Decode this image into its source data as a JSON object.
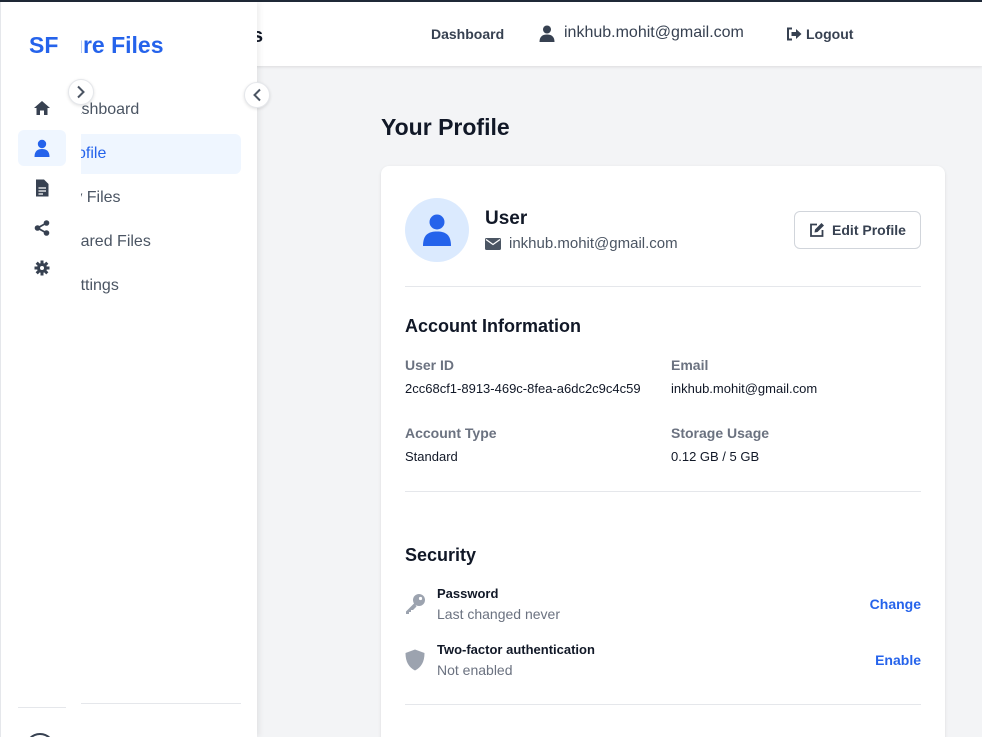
{
  "topbar": {
    "brand_fragment": "s",
    "nav_dashboard": "Dashboard",
    "user_email": "inkhub.mohit@gmail.com",
    "logout_label": "Logout"
  },
  "sidebar": {
    "brand_full": "Secure Files",
    "brand_short": "SF",
    "items": [
      {
        "label": "Dashboard",
        "icon": "home-icon",
        "active": false
      },
      {
        "label": "Profile",
        "icon": "user-icon",
        "active": true
      },
      {
        "label": "My Files",
        "icon": "file-icon",
        "active": false
      },
      {
        "label": "Shared Files",
        "icon": "share-icon",
        "active": false
      },
      {
        "label": "Settings",
        "icon": "gear-icon",
        "active": false
      }
    ]
  },
  "page": {
    "title": "Your Profile"
  },
  "profile": {
    "name": "User",
    "email": "inkhub.mohit@gmail.com",
    "edit_label": "Edit Profile"
  },
  "account": {
    "title": "Account Information",
    "user_id_label": "User ID",
    "user_id": "2cc68cf1-8913-469c-8fea-a6dc2c9c4c59",
    "email_label": "Email",
    "email": "inkhub.mohit@gmail.com",
    "type_label": "Account Type",
    "type": "Standard",
    "storage_label": "Storage Usage",
    "storage": "0.12 GB / 5 GB"
  },
  "security": {
    "title": "Security",
    "password_title": "Password",
    "password_sub": "Last changed never",
    "password_action": "Change",
    "twofa_title": "Two-factor authentication",
    "twofa_sub": "Not enabled",
    "twofa_action": "Enable"
  },
  "colors": {
    "accent": "#2563eb",
    "accent_light": "#dbeafe",
    "active_bg": "#eff6ff",
    "text_muted": "#6b7280"
  }
}
